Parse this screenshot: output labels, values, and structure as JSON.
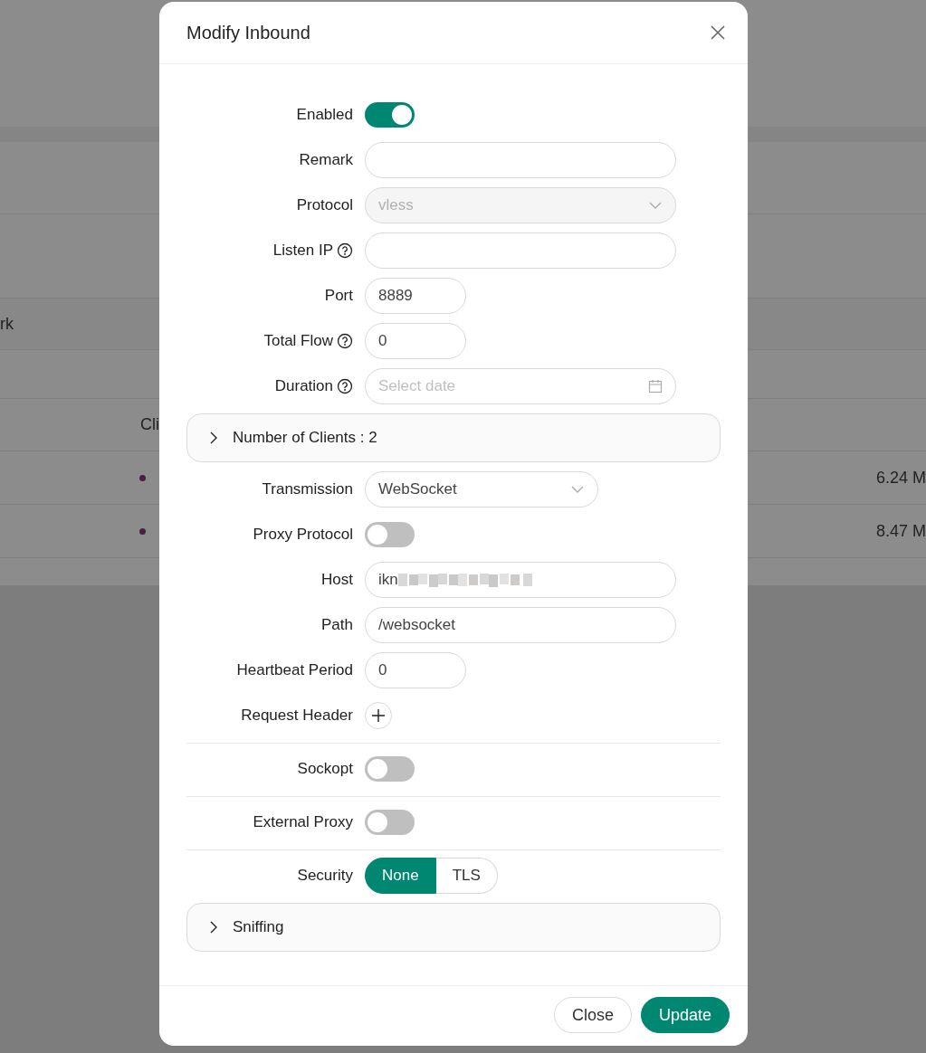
{
  "background": {
    "header_cell": "rk",
    "column_header": "Cli",
    "rows": [
      {
        "traffic": "6.24 M"
      },
      {
        "traffic": "8.47 M"
      }
    ]
  },
  "dialog": {
    "title": "Modify Inbound",
    "items": [
      {
        "kind": "switch",
        "label": "Enabled",
        "on": true
      },
      {
        "kind": "text",
        "label": "Remark"
      },
      {
        "kind": "select",
        "label": "Protocol",
        "value": "vless",
        "disabled": true
      },
      {
        "kind": "text",
        "label": "Listen IP",
        "help": true
      },
      {
        "kind": "number",
        "label": "Port",
        "value": "8889"
      },
      {
        "kind": "number",
        "label": "Total Flow",
        "help": true,
        "value": "0"
      },
      {
        "kind": "date",
        "label": "Duration",
        "help": true,
        "placeholder": "Select date"
      },
      {
        "kind": "panel",
        "label": "Number of Clients : 2",
        "expanded": false
      },
      {
        "kind": "compact_select",
        "label": "Transmission",
        "value": "WebSocket",
        "disabled": false
      },
      {
        "kind": "switch",
        "label": "Proxy Protocol",
        "on": false
      },
      {
        "kind": "text",
        "label": "Host",
        "value": "ikn",
        "redacted": true
      },
      {
        "kind": "text",
        "label": "Path",
        "value": "/websocket"
      },
      {
        "kind": "number",
        "label": "Heartbeat Period",
        "value": "0"
      },
      {
        "kind": "add",
        "label": "Request Header"
      },
      {
        "kind": "switch",
        "label": "Sockopt",
        "on": false,
        "separated": true
      },
      {
        "kind": "switch",
        "label": "External Proxy",
        "on": false,
        "separated": true
      },
      {
        "kind": "segmented",
        "label": "Security",
        "separated": true,
        "options": [
          {
            "label": "None",
            "selected": true
          },
          {
            "label": "TLS",
            "selected": false
          }
        ]
      },
      {
        "kind": "panel",
        "label": "Sniffing",
        "expanded": false
      }
    ],
    "buttons": [
      {
        "label": "Close",
        "kind": "default"
      },
      {
        "label": "Update",
        "kind": "primary"
      }
    ]
  }
}
